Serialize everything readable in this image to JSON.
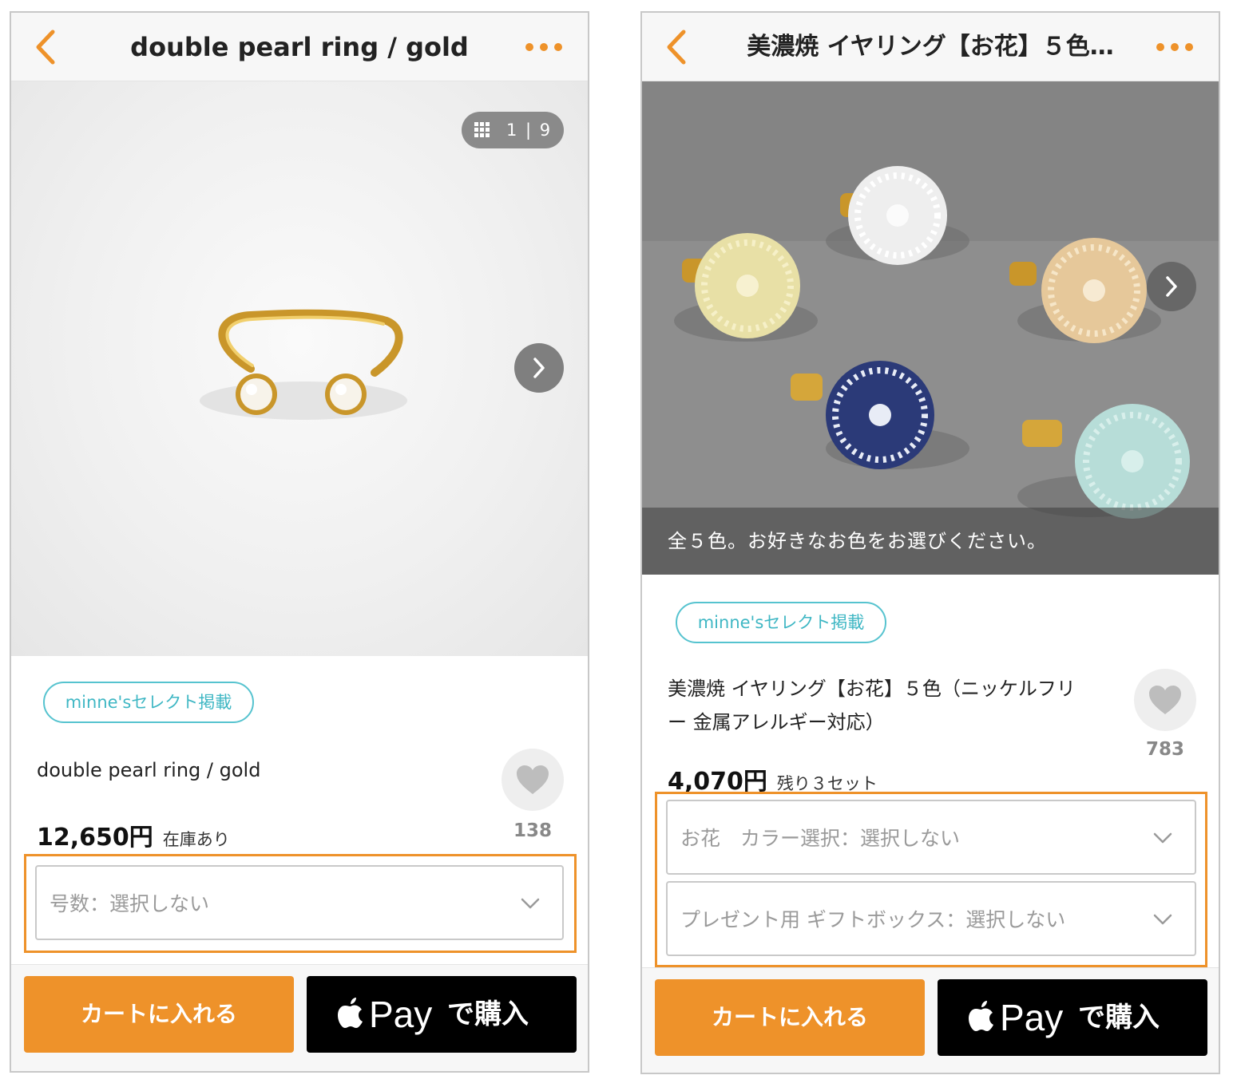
{
  "colors": {
    "accent": "#ee922a",
    "tag": "#3fb7c4",
    "pay_bg": "#000000"
  },
  "screen_a": {
    "nav": {
      "title": "double pearl ring / gold",
      "back_icon": "chevron-left-icon",
      "more_icon": "more-dots-icon"
    },
    "photo": {
      "counter": "1 | 9",
      "next_icon": "chevron-right-icon"
    },
    "tag": "minne'sセレクト掲載",
    "product": {
      "title": "double pearl ring / gold",
      "price": "12,650円",
      "stock": "在庫あり",
      "favorites": "138"
    },
    "options": [
      "号数：選択しない"
    ],
    "buttons": {
      "cart": "カートに入れる",
      "pay": "Pay",
      "pay_suffix": "で購入"
    }
  },
  "screen_b": {
    "nav": {
      "title": "美濃焼 イヤリング【お花】５色…",
      "back_icon": "chevron-left-icon",
      "more_icon": "more-dots-icon"
    },
    "photo": {
      "caption": "全５色。お好きなお色をお選びください。",
      "next_icon": "chevron-right-icon"
    },
    "tag": "minne'sセレクト掲載",
    "product": {
      "title_line1": "美濃焼 イヤリング【お花】５色（ニッケルフリ",
      "title_line2": "ー 金属アレルギー対応）",
      "price": "4,070円",
      "stock": "残り３セット",
      "favorites": "783"
    },
    "options": [
      "お花　カラー選択：選択しない",
      "プレゼント用 ギフトボックス：選択しない"
    ],
    "buttons": {
      "cart": "カートに入れる",
      "pay": "Pay",
      "pay_suffix": "で購入"
    }
  }
}
